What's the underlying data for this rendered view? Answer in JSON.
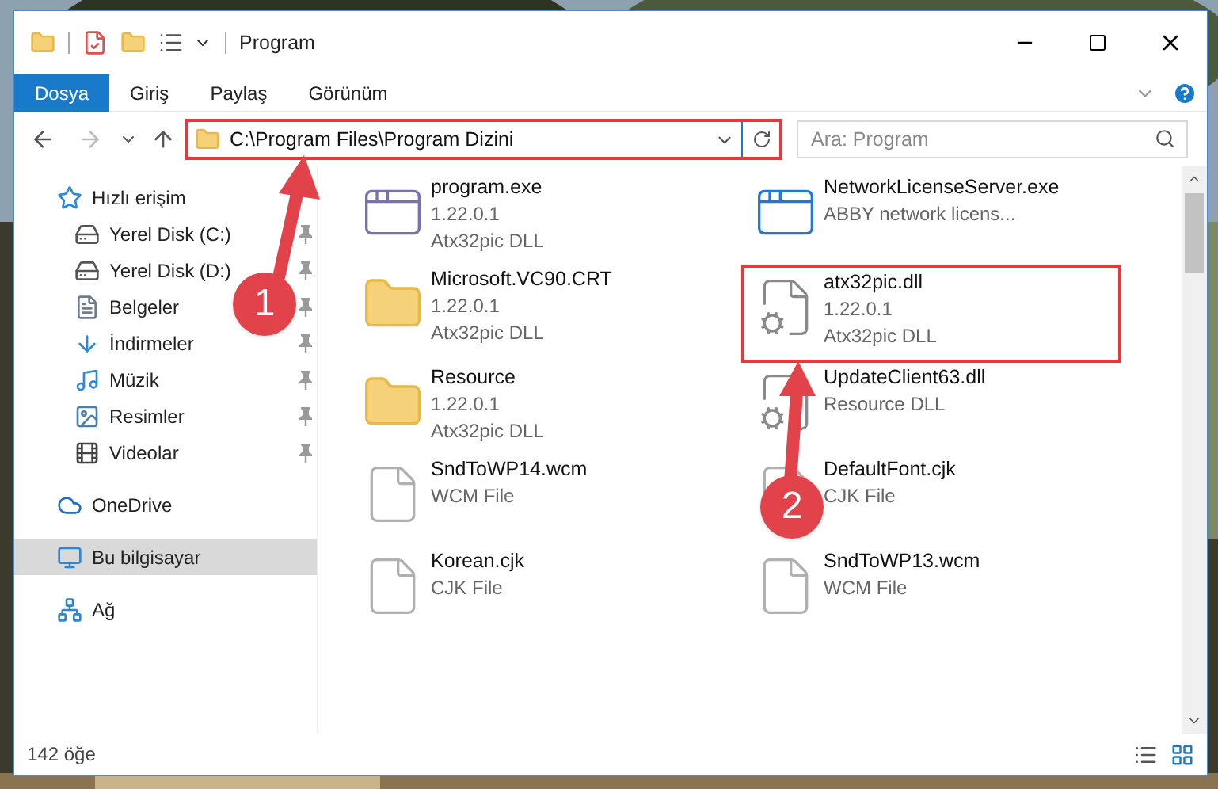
{
  "window": {
    "title": "Program"
  },
  "ribbon_tabs": [
    {
      "label": "Dosya",
      "selected": true
    },
    {
      "label": "Giriş",
      "selected": false
    },
    {
      "label": "Paylaş",
      "selected": false
    },
    {
      "label": "Görünüm",
      "selected": false
    }
  ],
  "address_bar": {
    "path": "C:\\Program Files\\Program Dizini",
    "highlighted": true
  },
  "search": {
    "placeholder": "Ara: Program"
  },
  "sidebar": {
    "items": [
      {
        "label": "Hızlı erişim",
        "selected": false,
        "children": [
          {
            "label": "Yerel Disk (C:)",
            "pinned": true,
            "selected": false
          },
          {
            "label": "Yerel Disk (D:)",
            "pinned": true,
            "selected": false
          },
          {
            "label": "Belgeler",
            "pinned": true,
            "selected": false
          },
          {
            "label": "İndirmeler",
            "pinned": true,
            "selected": false
          },
          {
            "label": "Müzik",
            "pinned": true,
            "selected": false
          },
          {
            "label": "Resimler",
            "pinned": true,
            "selected": false
          },
          {
            "label": "Videolar",
            "pinned": true,
            "selected": false
          }
        ]
      },
      {
        "label": "OneDrive",
        "selected": false
      },
      {
        "label": "Bu bilgisayar",
        "selected": true
      },
      {
        "label": "Ağ",
        "selected": false
      }
    ]
  },
  "files": [
    {
      "name": "program.exe",
      "lines": [
        "1.22.0.1",
        "Atx32pic DLL"
      ],
      "kind": "exe",
      "highlighted": false
    },
    {
      "name": "NetworkLicenseServer.exe",
      "lines": [
        "ABBY network licens..."
      ],
      "kind": "app",
      "highlighted": false
    },
    {
      "name": "Microsoft.VC90.CRT",
      "lines": [
        "1.22.0.1",
        "Atx32pic DLL"
      ],
      "kind": "folder",
      "highlighted": false
    },
    {
      "name": "atx32pic.dll",
      "lines": [
        "1.22.0.1",
        "Atx32pic DLL"
      ],
      "kind": "dll",
      "highlighted": true
    },
    {
      "name": "Resource",
      "lines": [
        "1.22.0.1",
        "Atx32pic DLL"
      ],
      "kind": "folder",
      "highlighted": false
    },
    {
      "name": "UpdateClient63.dll",
      "lines": [
        "Resource DLL"
      ],
      "kind": "dll",
      "highlighted": false
    },
    {
      "name": "SndToWP14.wcm",
      "lines": [
        "WCM File"
      ],
      "kind": "file",
      "highlighted": false
    },
    {
      "name": "DefaultFont.cjk",
      "lines": [
        "CJK File"
      ],
      "kind": "file",
      "highlighted": false
    },
    {
      "name": "Korean.cjk",
      "lines": [
        "CJK File"
      ],
      "kind": "file",
      "highlighted": false
    },
    {
      "name": "SndToWP13.wcm",
      "lines": [
        "WCM File"
      ],
      "kind": "file",
      "highlighted": false
    }
  ],
  "status_bar": {
    "count": "142 öğe"
  },
  "annotations": [
    {
      "label": "1"
    },
    {
      "label": "2"
    }
  ]
}
